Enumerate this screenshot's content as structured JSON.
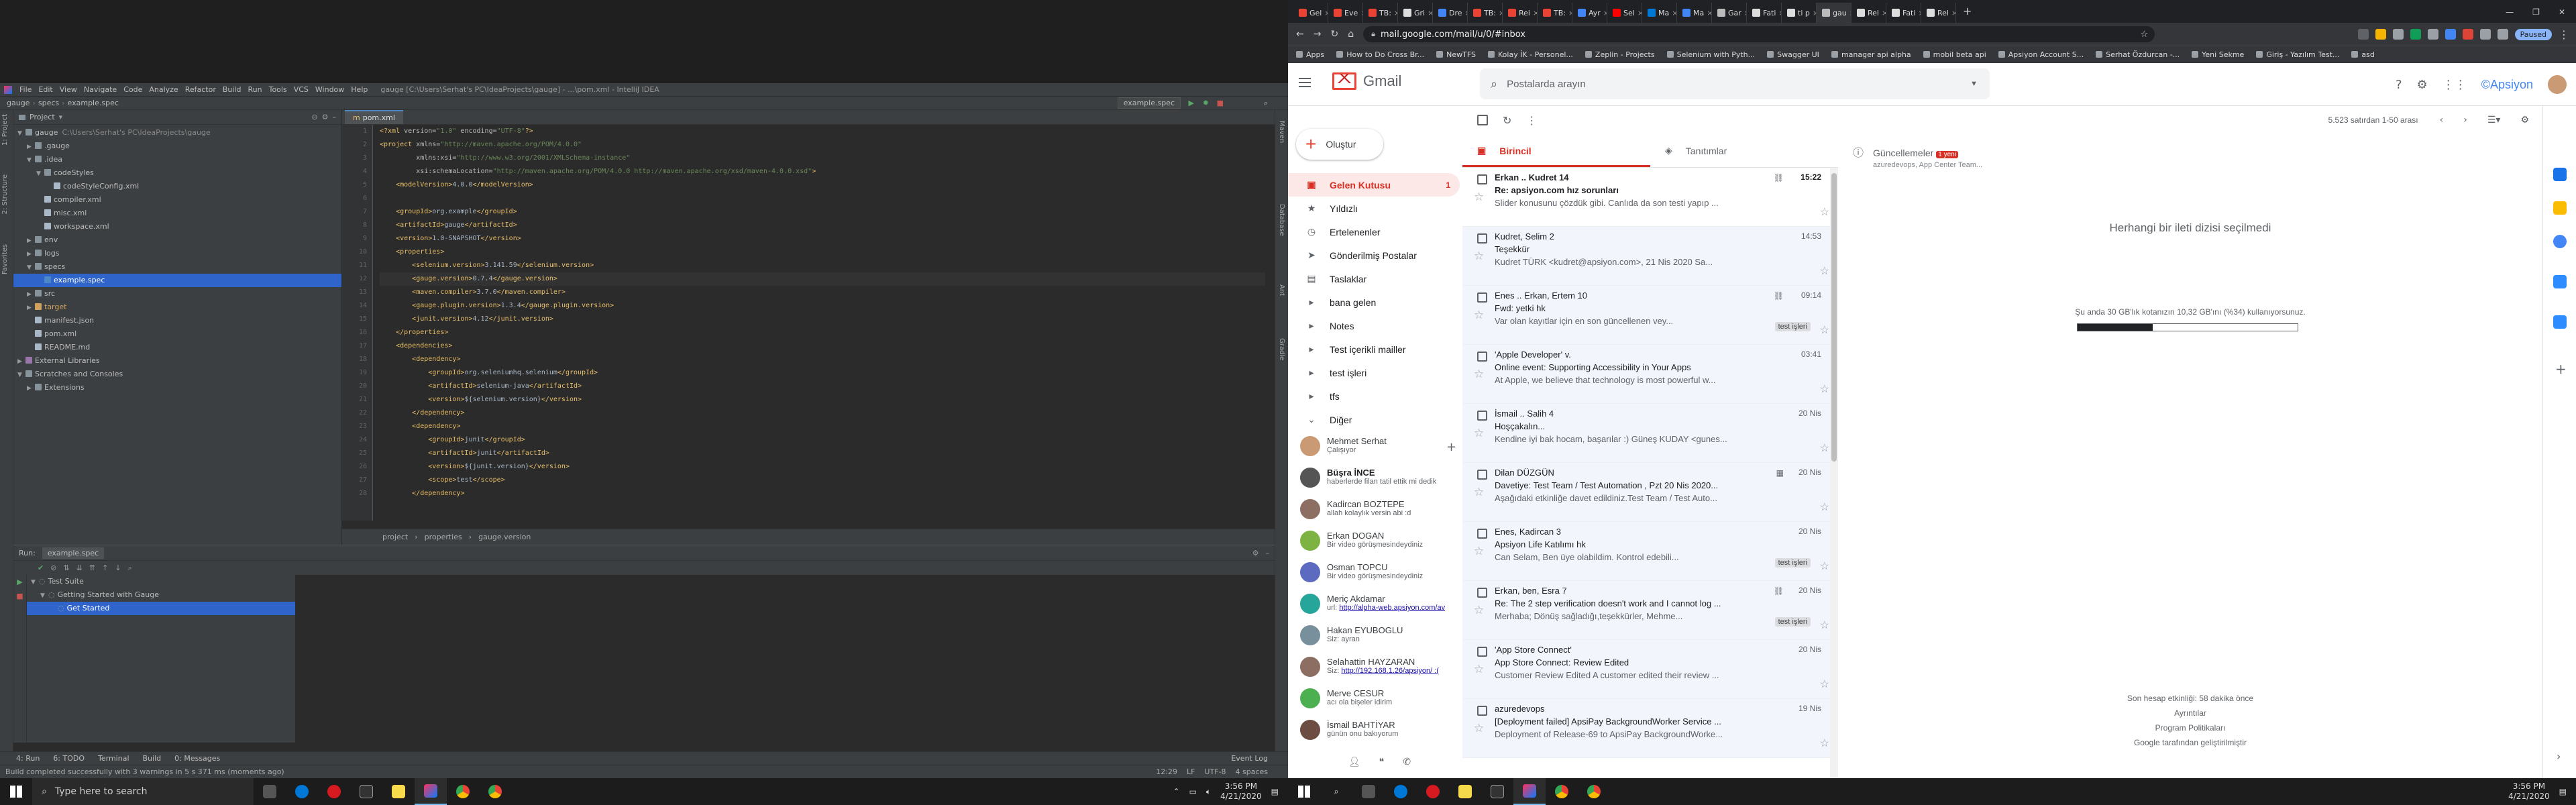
{
  "ide": {
    "menu": [
      "File",
      "Edit",
      "View",
      "Navigate",
      "Code",
      "Analyze",
      "Refactor",
      "Build",
      "Run",
      "Tools",
      "VCS",
      "Window",
      "Help"
    ],
    "window_title": "gauge [C:\\Users\\Serhat's PC\\IdeaProjects\\gauge] - ...\\pom.xml - IntelliJ IDEA",
    "breadcrumb": [
      "gauge",
      "specs",
      "example.spec"
    ],
    "run_config": "example.spec",
    "side_tabs_left": [
      "1: Project",
      "2: Structure",
      "Favorites"
    ],
    "side_tabs_right": [
      "Maven",
      "Database",
      "Ant",
      "Gradle"
    ],
    "project_panel_title": "Project",
    "tree": [
      {
        "label": "gauge",
        "hint": "C:\\Users\\Serhat's PC\\IdeaProjects\\gauge",
        "depth": 0,
        "type": "folder",
        "open": true
      },
      {
        "label": ".gauge",
        "depth": 1,
        "type": "folder"
      },
      {
        "label": ".idea",
        "depth": 1,
        "type": "folder",
        "open": true
      },
      {
        "label": "codeStyles",
        "depth": 2,
        "type": "folder",
        "open": true
      },
      {
        "label": "codeStyleConfig.xml",
        "depth": 3,
        "type": "file"
      },
      {
        "label": "compiler.xml",
        "depth": 2,
        "type": "file"
      },
      {
        "label": "misc.xml",
        "depth": 2,
        "type": "file"
      },
      {
        "label": "workspace.xml",
        "depth": 2,
        "type": "file"
      },
      {
        "label": "env",
        "depth": 1,
        "type": "folder"
      },
      {
        "label": "logs",
        "depth": 1,
        "type": "folder"
      },
      {
        "label": "specs",
        "depth": 1,
        "type": "folder",
        "open": true
      },
      {
        "label": "example.spec",
        "depth": 2,
        "type": "spec",
        "selected": true
      },
      {
        "label": "src",
        "depth": 1,
        "type": "folder"
      },
      {
        "label": "target",
        "depth": 1,
        "type": "target"
      },
      {
        "label": "manifest.json",
        "depth": 1,
        "type": "file"
      },
      {
        "label": "pom.xml",
        "depth": 1,
        "type": "file"
      },
      {
        "label": "README.md",
        "depth": 1,
        "type": "file"
      },
      {
        "label": "External Libraries",
        "depth": 0,
        "type": "lib"
      },
      {
        "label": "Scratches and Consoles",
        "depth": 0,
        "type": "folder",
        "open": true
      },
      {
        "label": "Extensions",
        "depth": 1,
        "type": "folder"
      }
    ],
    "editor_tab": "pom.xml",
    "code_lines": [
      [
        [
          "t-tag",
          "<?xml "
        ],
        [
          "t-attr",
          "version="
        ],
        [
          "t-val",
          "\"1.0\" "
        ],
        [
          "t-attr",
          "encoding="
        ],
        [
          "t-val",
          "\"UTF-8\""
        ],
        [
          "t-tag",
          "?>"
        ]
      ],
      [
        [
          "t-tag",
          "<project "
        ],
        [
          "t-attr",
          "xmlns="
        ],
        [
          "t-val",
          "\"http://maven.apache.org/POM/4.0.0\""
        ]
      ],
      [
        [
          "t-txt",
          "         "
        ],
        [
          "t-attr",
          "xmlns:xsi="
        ],
        [
          "t-val",
          "\"http://www.w3.org/2001/XMLSchema-instance\""
        ]
      ],
      [
        [
          "t-txt",
          "         "
        ],
        [
          "t-attr",
          "xsi:schemaLocation="
        ],
        [
          "t-val",
          "\"http://maven.apache.org/POM/4.0.0 http://maven.apache.org/xsd/maven-4.0.0.xsd\""
        ],
        [
          "t-tag",
          ">"
        ]
      ],
      [
        [
          "t-txt",
          "    "
        ],
        [
          "t-tag",
          "<modelVersion>"
        ],
        [
          "t-txt",
          "4.0.0"
        ],
        [
          "t-tag",
          "</modelVersion>"
        ]
      ],
      [
        [
          "t-txt",
          ""
        ]
      ],
      [
        [
          "t-txt",
          "    "
        ],
        [
          "t-tag",
          "<groupId>"
        ],
        [
          "t-txt",
          "org.example"
        ],
        [
          "t-tag",
          "</groupId>"
        ]
      ],
      [
        [
          "t-txt",
          "    "
        ],
        [
          "t-tag",
          "<artifactId>"
        ],
        [
          "t-txt",
          "gauge"
        ],
        [
          "t-tag",
          "</artifactId>"
        ]
      ],
      [
        [
          "t-txt",
          "    "
        ],
        [
          "t-tag",
          "<version>"
        ],
        [
          "t-txt",
          "1.0-SNAPSHOT"
        ],
        [
          "t-tag",
          "</version>"
        ]
      ],
      [
        [
          "t-txt",
          "    "
        ],
        [
          "t-tag",
          "<properties>"
        ]
      ],
      [
        [
          "t-txt",
          "        "
        ],
        [
          "t-tag",
          "<selenium.version>"
        ],
        [
          "t-txt",
          "3.141.59"
        ],
        [
          "t-tag",
          "</selenium.version>"
        ]
      ],
      [
        [
          "t-txt",
          "        "
        ],
        [
          "t-tag",
          "<gauge.version>"
        ],
        [
          "t-txt",
          "0.7.4"
        ],
        [
          "t-tag",
          "</gauge.version>"
        ]
      ],
      [
        [
          "t-txt",
          "        "
        ],
        [
          "t-tag",
          "<maven.compiler>"
        ],
        [
          "t-txt",
          "3.7.0"
        ],
        [
          "t-tag",
          "</maven.compiler>"
        ]
      ],
      [
        [
          "t-txt",
          "        "
        ],
        [
          "t-tag",
          "<gauge.plugin.version>"
        ],
        [
          "t-txt",
          "1.3.4"
        ],
        [
          "t-tag",
          "</gauge.plugin.version>"
        ]
      ],
      [
        [
          "t-txt",
          "        "
        ],
        [
          "t-tag",
          "<junit.version>"
        ],
        [
          "t-txt",
          "4.12"
        ],
        [
          "t-tag",
          "</junit.version>"
        ]
      ],
      [
        [
          "t-txt",
          "    "
        ],
        [
          "t-tag",
          "</properties>"
        ]
      ],
      [
        [
          "t-txt",
          "    "
        ],
        [
          "t-tag",
          "<dependencies>"
        ]
      ],
      [
        [
          "t-txt",
          "        "
        ],
        [
          "t-tag",
          "<dependency>"
        ]
      ],
      [
        [
          "t-txt",
          "            "
        ],
        [
          "t-tag",
          "<groupId>"
        ],
        [
          "t-txt",
          "org.seleniumhq.selenium"
        ],
        [
          "t-tag",
          "</groupId>"
        ]
      ],
      [
        [
          "t-txt",
          "            "
        ],
        [
          "t-tag",
          "<artifactId>"
        ],
        [
          "t-txt",
          "selenium-java"
        ],
        [
          "t-tag",
          "</artifactId>"
        ]
      ],
      [
        [
          "t-txt",
          "            "
        ],
        [
          "t-tag",
          "<version>"
        ],
        [
          "t-txt",
          "${selenium.version}"
        ],
        [
          "t-tag",
          "</version>"
        ]
      ],
      [
        [
          "t-txt",
          "        "
        ],
        [
          "t-tag",
          "</dependency>"
        ]
      ],
      [
        [
          "t-txt",
          "        "
        ],
        [
          "t-tag",
          "<dependency>"
        ]
      ],
      [
        [
          "t-txt",
          "            "
        ],
        [
          "t-tag",
          "<groupId>"
        ],
        [
          "t-txt",
          "junit"
        ],
        [
          "t-tag",
          "</groupId>"
        ]
      ],
      [
        [
          "t-txt",
          "            "
        ],
        [
          "t-tag",
          "<artifactId>"
        ],
        [
          "t-txt",
          "junit"
        ],
        [
          "t-tag",
          "</artifactId>"
        ]
      ],
      [
        [
          "t-txt",
          "            "
        ],
        [
          "t-tag",
          "<version>"
        ],
        [
          "t-txt",
          "${junit.version}"
        ],
        [
          "t-tag",
          "</version>"
        ]
      ],
      [
        [
          "t-txt",
          "            "
        ],
        [
          "t-tag",
          "<scope>"
        ],
        [
          "t-txt",
          "test"
        ],
        [
          "t-tag",
          "</scope>"
        ]
      ],
      [
        [
          "t-txt",
          "        "
        ],
        [
          "t-tag",
          "</dependency>"
        ]
      ]
    ],
    "current_line": 12,
    "editor_breadcrumb": [
      "project",
      "properties",
      "gauge.version"
    ],
    "run_panel": {
      "label": "Run:",
      "config": "example.spec"
    },
    "run_tree": [
      {
        "label": "Test Suite",
        "depth": 0
      },
      {
        "label": "Getting Started with Gauge",
        "depth": 1
      },
      {
        "label": "Get Started",
        "depth": 2,
        "selected": true
      }
    ],
    "bottom_tabs": [
      "4: Run",
      "6: TODO",
      "Terminal",
      "Build",
      "0: Messages"
    ],
    "event_log": "Event Log",
    "status_text": "Build completed successfully with 3 warnings in 5 s 371 ms (moments ago)",
    "status_right": [
      "12:29",
      "LF",
      "UTF-8",
      "4 spaces"
    ]
  },
  "browser": {
    "tabs": [
      {
        "label": "Gel",
        "color": "#ea4335"
      },
      {
        "label": "Eve",
        "color": "#ea4335"
      },
      {
        "label": "TB:",
        "color": "#ea4335"
      },
      {
        "label": "Gri",
        "color": "#dddddd"
      },
      {
        "label": "Dre",
        "color": "#4285f4"
      },
      {
        "label": "TB:",
        "color": "#ea4335"
      },
      {
        "label": "Rei",
        "color": "#ea4335"
      },
      {
        "label": "TB:",
        "color": "#ea4335"
      },
      {
        "label": "Ayr",
        "color": "#4285f4"
      },
      {
        "label": "Sel",
        "color": "#ff0000"
      },
      {
        "label": "Ma",
        "color": "#0078d4"
      },
      {
        "label": "Ma",
        "color": "#4285f4"
      },
      {
        "label": "Gar",
        "color": "#bbbbbb"
      },
      {
        "label": "Fati",
        "color": "#dddddd"
      },
      {
        "label": "ti p",
        "color": "#dddddd"
      },
      {
        "label": "gau",
        "color": "#bbbbbb",
        "active": true
      },
      {
        "label": "Rel",
        "color": "#dddddd"
      },
      {
        "label": "Fati",
        "color": "#dddddd"
      },
      {
        "label": "Rel",
        "color": "#dddddd"
      }
    ],
    "url": "mail.google.com/mail/u/0/#inbox",
    "paused_label": "Paused",
    "bookmarks": [
      "Apps",
      "How to Do Cross Br...",
      "NewTFS",
      "Kolay İK - Personel...",
      "Zeplin - Projects",
      "Selenium with Pyth...",
      "Swagger UI",
      "manager api alpha",
      "mobil beta api",
      "Apsiyon Account S...",
      "Serhat Özdurcan -...",
      "Yeni Sekme",
      "Giriş - Yazılım Test...",
      "asd"
    ]
  },
  "gmail": {
    "logo_text": "Gmail",
    "search_placeholder": "Postalarda arayın",
    "brand": "©Apsiyon",
    "compose": "Oluştur",
    "folders": [
      {
        "label": "Gelen Kutusu",
        "icon": "▣",
        "count": "1",
        "active": true
      },
      {
        "label": "Yıldızlı",
        "icon": "★"
      },
      {
        "label": "Ertelenenler",
        "icon": "◷"
      },
      {
        "label": "Gönderilmiş Postalar",
        "icon": "➤"
      },
      {
        "label": "Taslaklar",
        "icon": "▤"
      },
      {
        "label": "bana gelen",
        "icon": "▸"
      },
      {
        "label": "Notes",
        "icon": "▸"
      },
      {
        "label": "Test içerikli mailler",
        "icon": "▸"
      },
      {
        "label": "test işleri",
        "icon": "▸"
      },
      {
        "label": "tfs",
        "icon": "▸"
      },
      {
        "label": "Diğer",
        "icon": "⌄"
      }
    ],
    "hangouts": [
      {
        "name": "Mehmet Serhat",
        "msg": "Çalışıyor",
        "color": "#c99a74",
        "bold": false
      },
      {
        "name": "Büşra İNCE",
        "msg": "haberlerde filan tatil ettik mi dedik",
        "color": "#555",
        "bold": true
      },
      {
        "name": "Kadircan BOZTEPE",
        "msg": "allah kolaylık versin abi :d",
        "color": "#8d6e63",
        "bold": false
      },
      {
        "name": "Erkan DOGAN",
        "msg": "Bir video görüşmesindeydiniz",
        "color": "#7cb342",
        "bold": false
      },
      {
        "name": "Osman TOPCU",
        "msg": "Bir video görüşmesindeydiniz",
        "color": "#5c6bc0",
        "bold": false
      },
      {
        "name": "Meriç Akdamar",
        "msg": "url: ",
        "link": "http://alpha-web.apsiyon.com/av",
        "color": "#26a69a",
        "bold": false
      },
      {
        "name": "Hakan EYUBOGLU",
        "msg": "Siz: ayran",
        "color": "#78909c",
        "bold": false
      },
      {
        "name": "Selahattin HAYZARAN",
        "msg": "Siz: ",
        "link": "http://192.168.1.26/apsiyon/ :(",
        "color": "#8d6e63",
        "bold": false
      },
      {
        "name": "Merve CESUR",
        "msg": "acı ola bişeler idirim",
        "color": "#4caf50",
        "bold": false
      },
      {
        "name": "İsmail BAHTİYAR",
        "msg": "günün onu bakıyorum",
        "color": "#6d4c41",
        "bold": false
      }
    ],
    "pagination": "5.523 satırdan 1-50 arası",
    "tabs": [
      {
        "label": "Birincil",
        "icon": "▣",
        "active": true
      },
      {
        "label": "Tanıtımlar",
        "icon": "◈"
      }
    ],
    "updates_tab": {
      "label": "Güncellemeler",
      "badge": "1 yeni",
      "sub": "azuredevops, App Center Team..."
    },
    "emails": [
      {
        "from": "Erkan .. Kudret 14",
        "date": "15:22",
        "subject": "Re: apsiyon.com hız sorunları",
        "snippet": "Slider konusunu çözdük gibi. Canlıda da son testi yapıp ...",
        "unread": true,
        "clip": "⛓"
      },
      {
        "from": "Kudret, Selim 2",
        "date": "14:53",
        "subject": "Teşekkür",
        "snippet": "Kudret TÜRK <kudret@apsiyon.com>, 21 Nis 2020 Sa...",
        "unread": false
      },
      {
        "from": "Enes .. Erkan, Ertem 10",
        "date": "09:14",
        "subject": "Fwd: yetki hk",
        "snippet": "Var olan kayıtlar için en son güncellenen vey...",
        "unread": false,
        "label": "test işleri",
        "clip": "⛓"
      },
      {
        "from": "'Apple Developer' v.",
        "date": "03:41",
        "subject": "Online event: Supporting Accessibility in Your Apps",
        "snippet": "At Apple, we believe that technology is most powerful w...",
        "unread": false
      },
      {
        "from": "İsmail .. Salih 4",
        "date": "20 Nis",
        "subject": "Hoşçakalın...",
        "snippet": "Kendine iyi bak hocam, başarılar :) Güneş KUDAY <gunes...",
        "unread": false
      },
      {
        "from": "Dilan DÜZGÜN",
        "date": "20 Nis",
        "subject": "Davetiye: Test Team / Test Automation , Pzt 20 Nis 2020...",
        "snippet": "Aşağıdaki etkinliğe davet edildiniz.Test Team / Test Auto...",
        "unread": false,
        "clip": "▦"
      },
      {
        "from": "Enes, Kadircan 3",
        "date": "20 Nis",
        "subject": "Apsiyon Life Katılımı hk",
        "snippet": "Can Selam, Ben üye olabildim. Kontrol edebili...",
        "unread": false,
        "label": "test işleri"
      },
      {
        "from": "Erkan, ben, Esra 7",
        "date": "20 Nis",
        "subject": "Re: The 2 step verification doesn't work and I cannot log ...",
        "snippet": "Merhaba; Dönüş sağladığı,teşekkürler, Mehme...",
        "unread": false,
        "label": "test işleri",
        "clip": "⛓"
      },
      {
        "from": "'App Store Connect'",
        "date": "20 Nis",
        "subject": "App Store Connect: Review Edited",
        "snippet": "Customer Review Edited A customer edited their review ...",
        "unread": false
      },
      {
        "from": "azuredevops",
        "date": "19 Nis",
        "subject": "[Deployment failed] ApsiPay BackgroundWorker Service ...",
        "snippet": "Deployment of Release-69 to ApsiPay BackgroundWorke...",
        "unread": false
      }
    ],
    "empty_text": "Herhangi bir ileti dizisi seçilmedi",
    "quota_text": "Şu anda 30 GB'lık kotanızın 10,32 GB'ını (%34) kullanıyorsunuz.",
    "quota_fraction": 0.34,
    "footer": [
      "Son hesap etkinliği: 58 dakika önce",
      "Ayrıntılar",
      "Program Politikaları",
      "Google tarafından geliştirilmiştir"
    ]
  },
  "taskbar_left": {
    "search_placeholder": "Type here to search",
    "time": "3:56 PM",
    "date": "4/21/2020"
  },
  "taskbar_right": {
    "time": "3:56 PM",
    "date": "4/21/2020"
  },
  "colors": {
    "gmail_red": "#d93025",
    "ide_bg": "#2b2b2b",
    "ide_panel": "#3c3f41",
    "selection": "#2f65ca"
  }
}
